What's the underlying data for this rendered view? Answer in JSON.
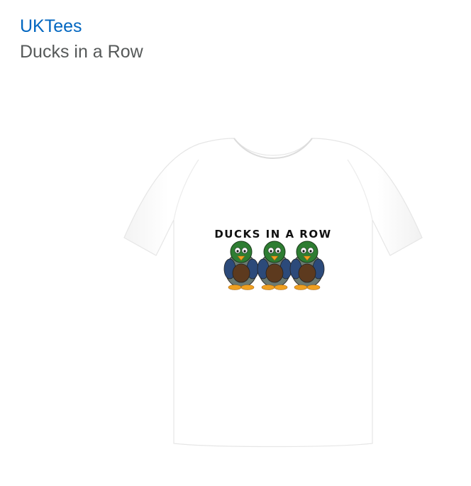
{
  "listing": {
    "brand": "UKTees",
    "title": "Ducks in a Row"
  },
  "product_image": {
    "print_text": "DUCKS IN A ROW",
    "icon": "tshirt-icon",
    "colors": {
      "shirt": "#ffffff",
      "duck_head": "#2e7d32",
      "duck_body": "#6b7a72",
      "duck_belly": "#5d3a1e",
      "duck_feet": "#f0a020",
      "duck_wing": "#2c4a7a"
    }
  },
  "theme": {
    "link_color": "#0066c0",
    "title_color": "#565959"
  }
}
